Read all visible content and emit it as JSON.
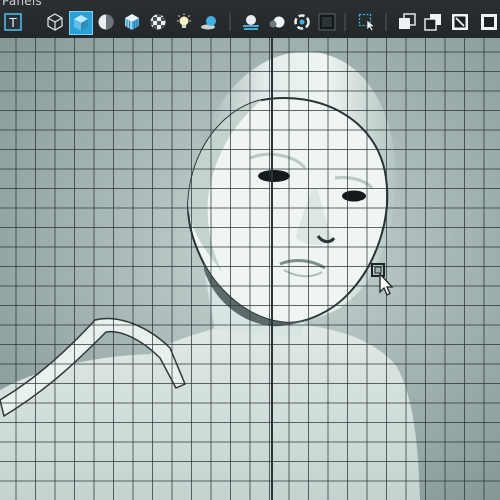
{
  "toolbar": {
    "panel_title": "Panels",
    "buttons": [
      {
        "id": "text",
        "icon": "text-tool-icon",
        "label": "T"
      },
      {
        "id": "wire-cube",
        "icon": "wireframe-cube-icon"
      },
      {
        "id": "shaded-cube",
        "icon": "shaded-cube-icon",
        "active": true
      },
      {
        "id": "half-sphere",
        "icon": "half-shaded-sphere-icon"
      },
      {
        "id": "textured-cube",
        "icon": "textured-cube-icon"
      },
      {
        "id": "checker-sphere",
        "icon": "checker-sphere-icon"
      },
      {
        "id": "light",
        "icon": "light-bulb-icon"
      },
      {
        "id": "shadow",
        "icon": "shadow-sphere-icon"
      },
      {
        "id": "ssao",
        "icon": "ambient-occlusion-icon"
      },
      {
        "id": "motion",
        "icon": "motion-blur-icon"
      },
      {
        "id": "aa",
        "icon": "anti-alias-icon"
      },
      {
        "id": "dof",
        "icon": "depth-of-field-icon"
      },
      {
        "id": "isolate",
        "icon": "isolate-select-icon"
      },
      {
        "id": "xray",
        "icon": "xray-icon"
      },
      {
        "id": "xray-joints",
        "icon": "xray-joints-icon"
      },
      {
        "id": "frame",
        "icon": "frame-camera-icon"
      }
    ]
  },
  "colors": {
    "toolbar_bg": "#252b2e",
    "active_accent": "#2aa1d6",
    "grid_line": "#283034",
    "model_light": "#e9f1ee",
    "model_shadow": "#a9bab6"
  }
}
